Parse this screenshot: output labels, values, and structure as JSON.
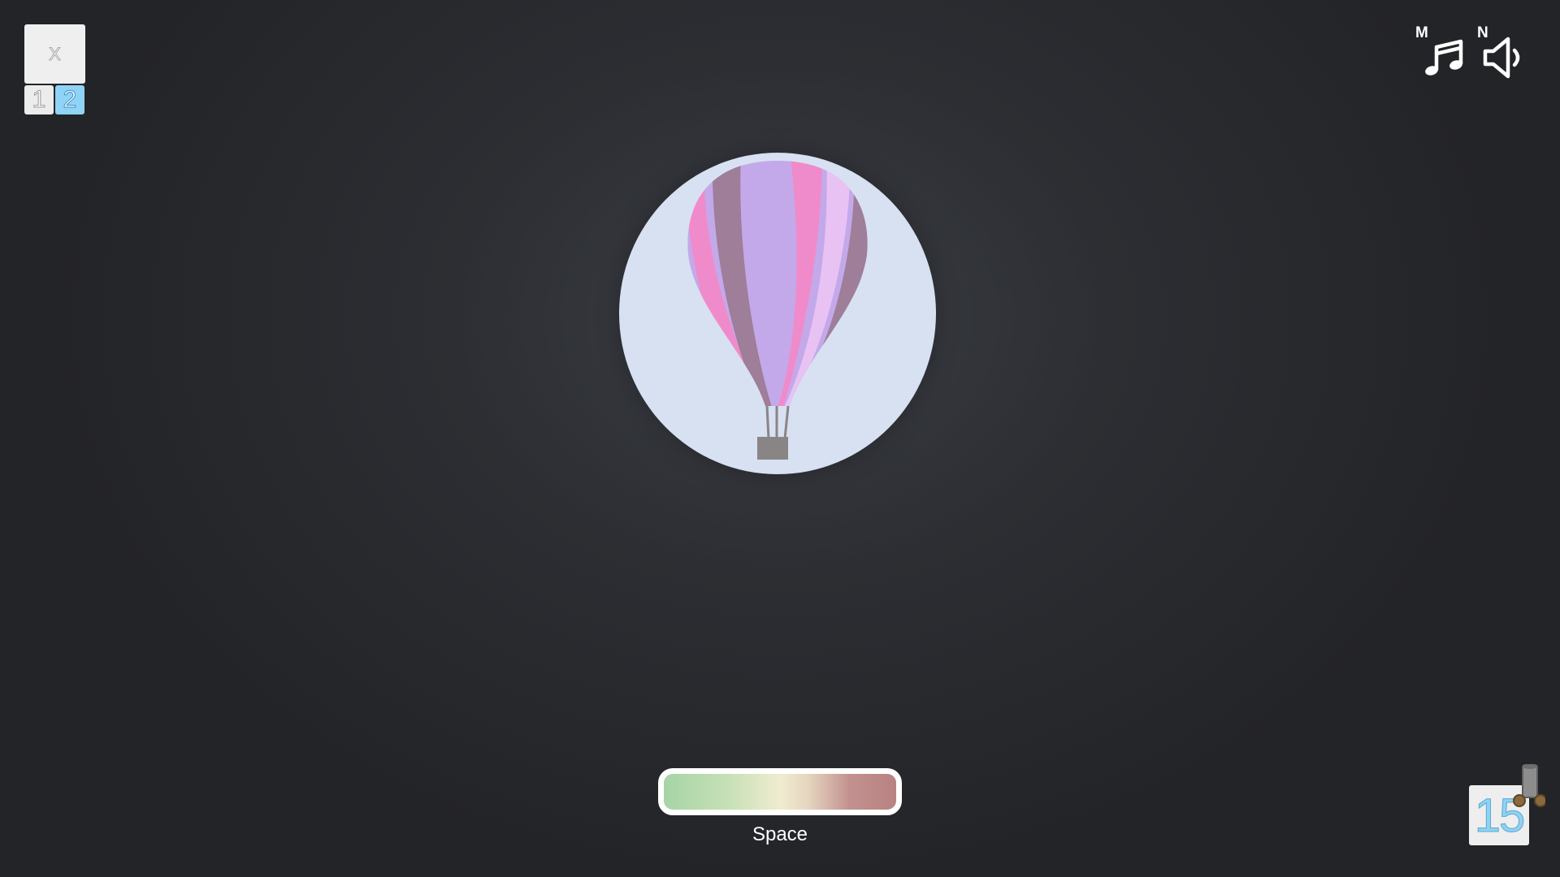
{
  "menu": {
    "close_label": "X",
    "levels": [
      {
        "label": "1",
        "active": false
      },
      {
        "label": "2",
        "active": true
      }
    ]
  },
  "audio": {
    "music": {
      "hotkey": "M",
      "icon": "music-note-icon"
    },
    "sound": {
      "hotkey": "N",
      "icon": "speaker-icon"
    }
  },
  "balloon": {
    "icon": "hot-air-balloon-icon",
    "colors": {
      "disc": "#d8e1f1",
      "pink": "#f08bcb",
      "lavender": "#c3a9ea",
      "mauve": "#9e7e98",
      "basket": "#8a8585"
    }
  },
  "meter": {
    "label": "Space",
    "colors": [
      "#a6d4a6",
      "#efecd0",
      "#b98282"
    ]
  },
  "counter": {
    "value": "15",
    "icon": "cannon-icon"
  }
}
